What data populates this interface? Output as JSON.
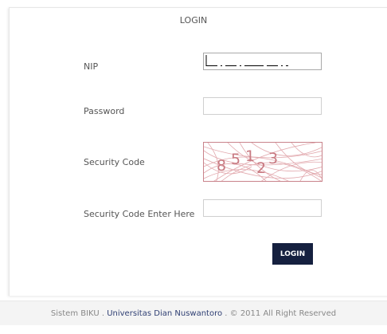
{
  "header": {
    "title": "LOGIN"
  },
  "form": {
    "nip_label": "NIP",
    "nip_value": "",
    "password_label": "Password",
    "password_value": "",
    "security_code_label": "Security Code",
    "captcha_text": "85123",
    "captcha_digits": [
      "8",
      "5",
      "1",
      "2",
      "3"
    ],
    "security_code_enter_label": "Security Code Enter Here",
    "security_code_value": "",
    "login_button_label": "LOGIN"
  },
  "footer": {
    "system_name": "Sistem BIKU",
    "separator1": " . ",
    "university_link": "Universitas Dian Nuswantoro",
    "separator2": " . ",
    "copyright": "© 2011 All Right Reserved"
  },
  "colors": {
    "button_bg": "#15203f",
    "captcha_border": "#c9838b",
    "captcha_digits": "#c87a82",
    "link": "#2f3f73"
  }
}
